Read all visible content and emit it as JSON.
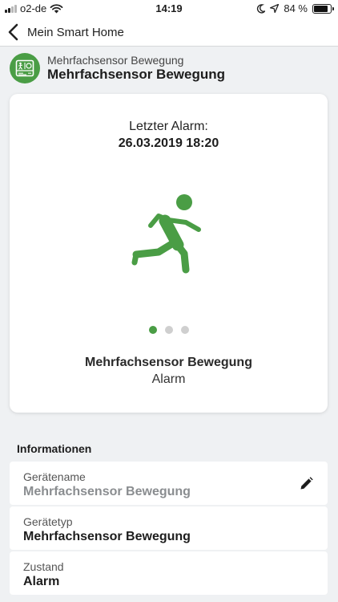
{
  "status_bar": {
    "carrier": "o2-de",
    "time": "14:19",
    "battery": "84 %",
    "battery_level": 0.84,
    "icons": [
      "signal-icon",
      "wifi-icon",
      "moon-icon",
      "location-arrow-icon",
      "battery-icon"
    ]
  },
  "nav": {
    "back_label": "Mein Smart Home",
    "back_icon": "chevron-left-icon"
  },
  "device": {
    "subtitle": "Mehrfachsensor Bewegung",
    "title": "Mehrfachsensor Bewegung",
    "icon": "multisensor-device-icon"
  },
  "card": {
    "alarm_label": "Letzter Alarm:",
    "alarm_date": "26.03.2019 18:20",
    "icon": "running-person-icon",
    "page_index": 0,
    "page_count": 3,
    "device_name": "Mehrfachsensor Bewegung",
    "state": "Alarm"
  },
  "info": {
    "section_title": "Informationen",
    "rows": [
      {
        "label": "Gerätename",
        "value": "Mehrfachsensor Bewegung",
        "editable": true
      },
      {
        "label": "Gerätetyp",
        "value": "Mehrfachsensor Bewegung"
      },
      {
        "label": "Zustand",
        "value": "Alarm"
      }
    ]
  },
  "colors": {
    "accent": "#4a9d45",
    "background": "#eff1f3",
    "card": "#ffffff",
    "muted_text": "#8a8d90"
  }
}
